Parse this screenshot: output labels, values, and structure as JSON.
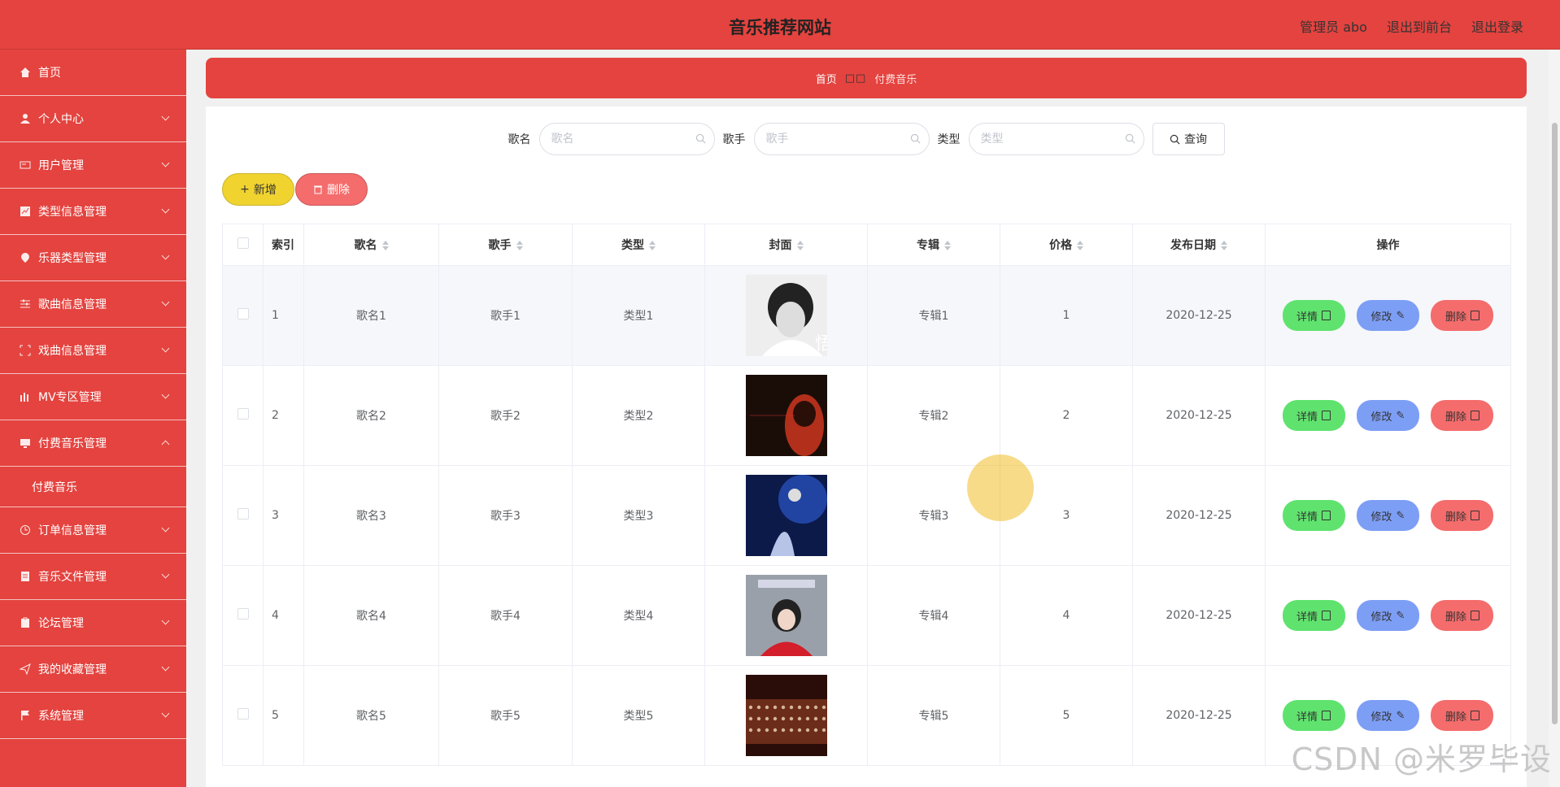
{
  "header": {
    "title": "音乐推荐网站",
    "links": [
      "管理员 abo",
      "退出到前台",
      "退出登录"
    ]
  },
  "sidebar": {
    "items": [
      {
        "label": "首页",
        "icon": "home-icon",
        "expandable": false
      },
      {
        "label": "个人中心",
        "icon": "user-icon",
        "expandable": true
      },
      {
        "label": "用户管理",
        "icon": "idcard-icon",
        "expandable": true
      },
      {
        "label": "类型信息管理",
        "icon": "chart-icon",
        "expandable": true
      },
      {
        "label": "乐器类型管理",
        "icon": "pin-icon",
        "expandable": true
      },
      {
        "label": "歌曲信息管理",
        "icon": "sliders-icon",
        "expandable": true
      },
      {
        "label": "戏曲信息管理",
        "icon": "fullscreen-icon",
        "expandable": true
      },
      {
        "label": "MV专区管理",
        "icon": "bars-icon",
        "expandable": true
      },
      {
        "label": "付费音乐管理",
        "icon": "monitor-icon",
        "expandable": true,
        "expanded": true
      }
    ],
    "sub_item": "付费音乐",
    "items_after": [
      {
        "label": "订单信息管理",
        "icon": "clock-icon"
      },
      {
        "label": "音乐文件管理",
        "icon": "list-icon"
      },
      {
        "label": "论坛管理",
        "icon": "clipboard-icon"
      },
      {
        "label": "我的收藏管理",
        "icon": "send-icon"
      },
      {
        "label": "系统管理",
        "icon": "flag-icon"
      }
    ]
  },
  "breadcrumb": {
    "home": "首页",
    "separator": "□□",
    "current": "付费音乐"
  },
  "search": {
    "song_label": "歌名",
    "song_placeholder": "歌名",
    "singer_label": "歌手",
    "singer_placeholder": "歌手",
    "type_label": "类型",
    "type_placeholder": "类型",
    "query_button": "查询"
  },
  "actions": {
    "add_button": "新增",
    "delete_button": "删除"
  },
  "table": {
    "headers": [
      "索引",
      "歌名",
      "歌手",
      "类型",
      "封面",
      "专辑",
      "价格",
      "发布日期",
      "操作"
    ],
    "rows": [
      {
        "index": "1",
        "song": "歌名1",
        "singer": "歌手1",
        "type": "类型1",
        "album": "专辑1",
        "price": "1",
        "date": "2020-12-25"
      },
      {
        "index": "2",
        "song": "歌名2",
        "singer": "歌手2",
        "type": "类型2",
        "album": "专辑2",
        "price": "2",
        "date": "2020-12-25"
      },
      {
        "index": "3",
        "song": "歌名3",
        "singer": "歌手3",
        "type": "类型3",
        "album": "专辑3",
        "price": "3",
        "date": "2020-12-25"
      },
      {
        "index": "4",
        "song": "歌名4",
        "singer": "歌手4",
        "type": "类型4",
        "album": "专辑4",
        "price": "4",
        "date": "2020-12-25"
      },
      {
        "index": "5",
        "song": "歌名5",
        "singer": "歌手5",
        "type": "类型5",
        "album": "专辑5",
        "price": "5",
        "date": "2020-12-25"
      }
    ],
    "row_buttons": {
      "detail": "详情",
      "edit": "修改",
      "remove": "删除"
    }
  },
  "watermark": "CSDN @米罗毕设",
  "colors": {
    "primary": "#e4433f",
    "add": "#f0d32e",
    "delete": "#f56c6c",
    "detail": "#5fe36e",
    "edit": "#7d9ef5"
  }
}
